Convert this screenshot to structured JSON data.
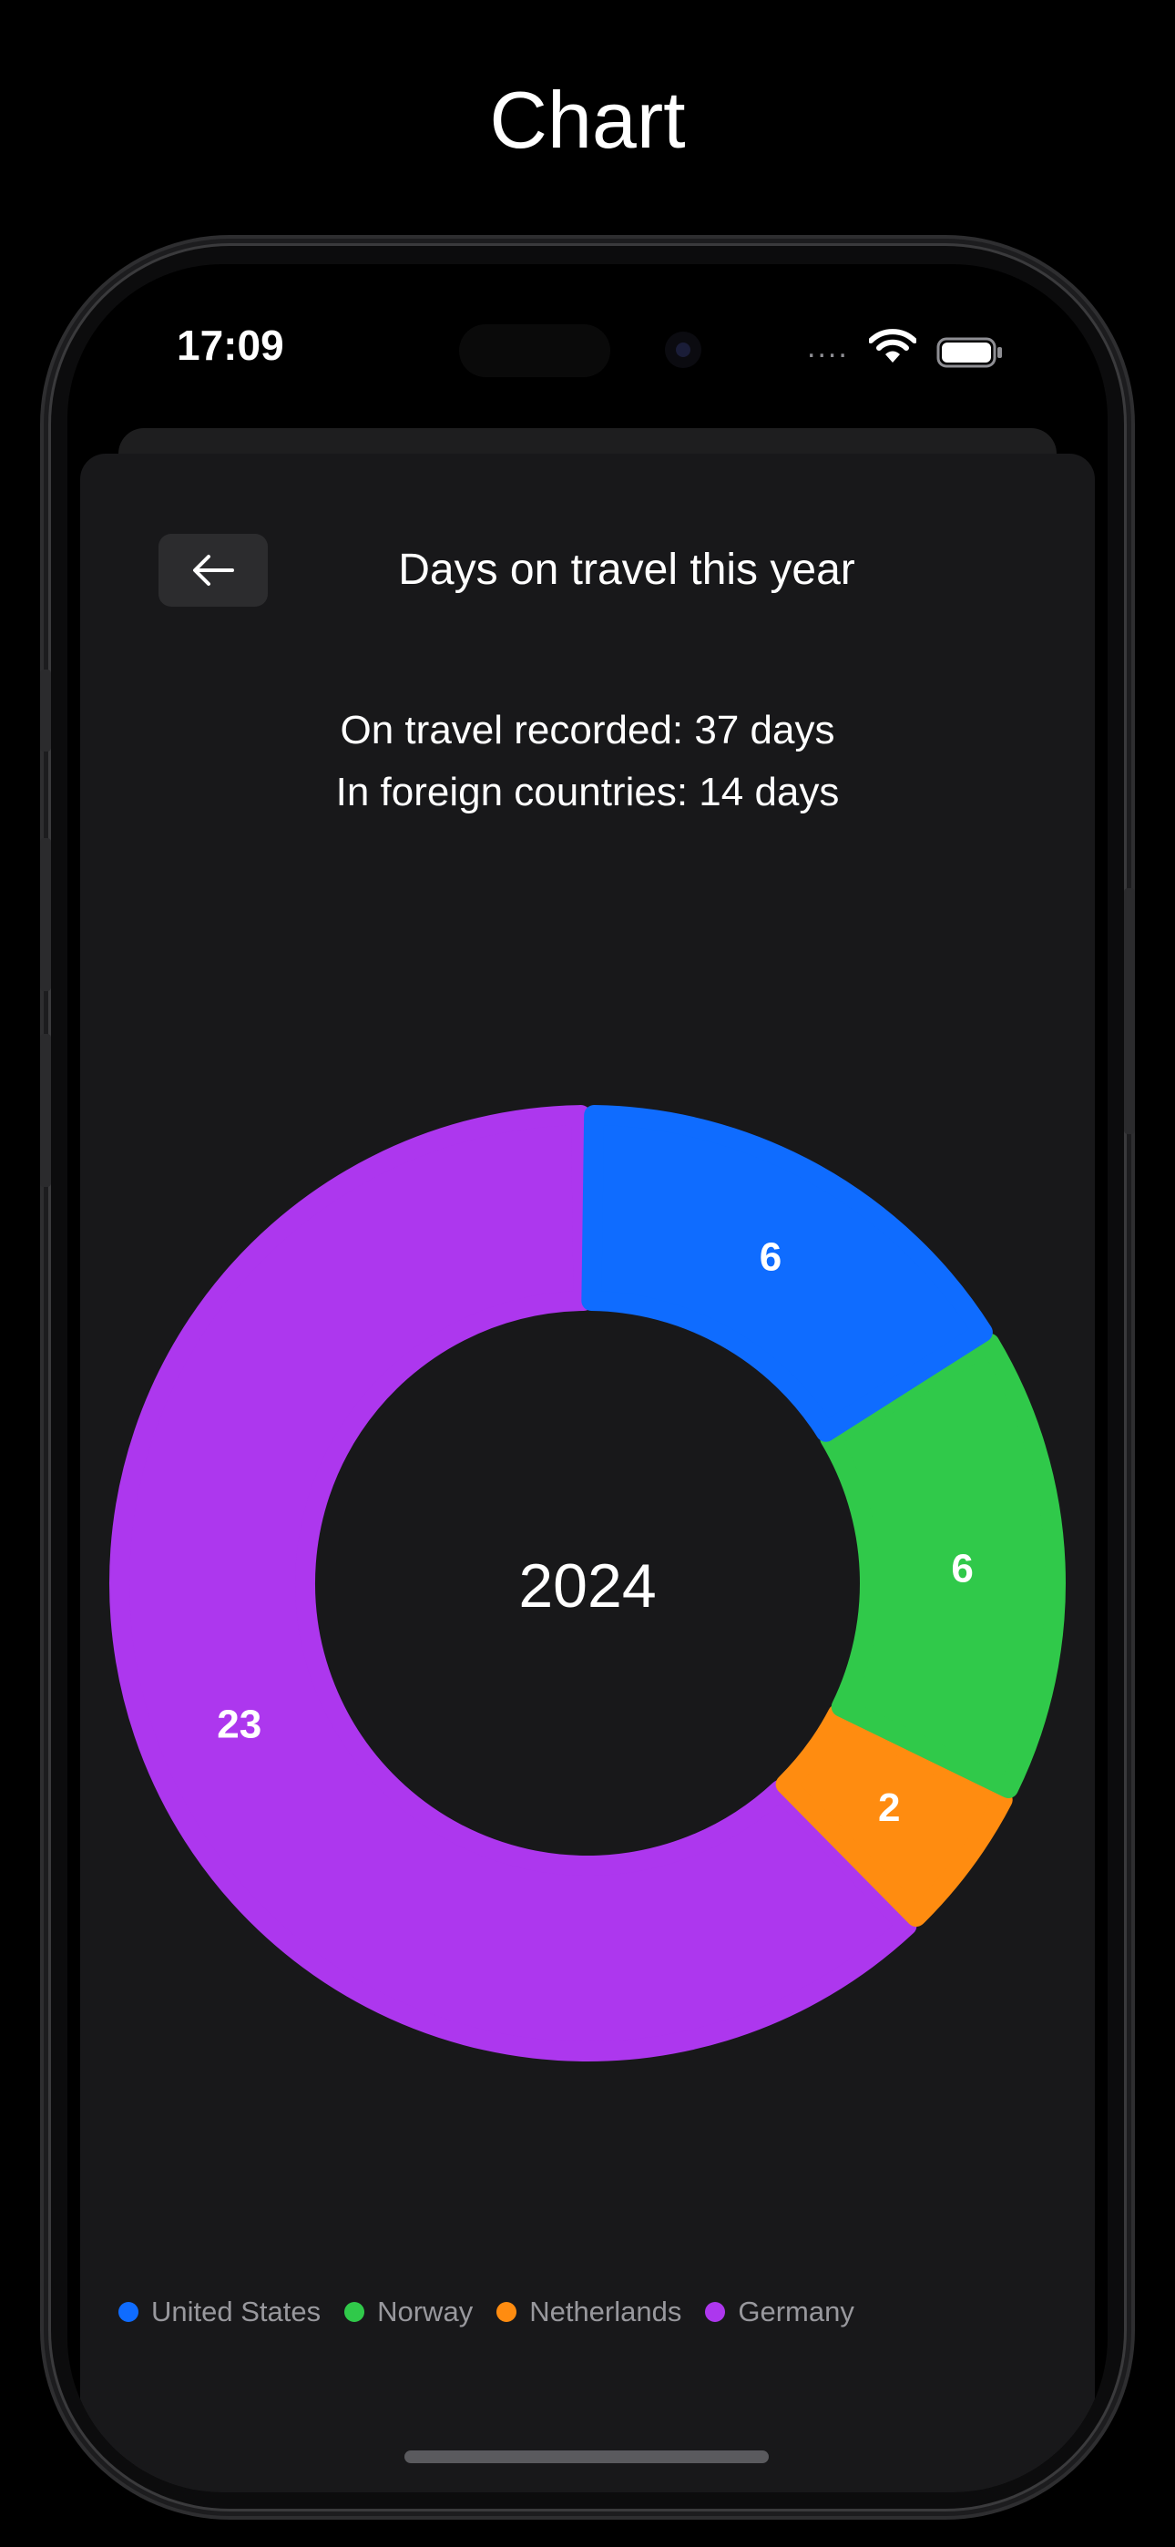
{
  "page": {
    "heading": "Chart"
  },
  "status_bar": {
    "time": "17:09",
    "signal": "....",
    "icons": [
      "wifi-icon",
      "battery-icon"
    ]
  },
  "nav": {
    "back_icon": "arrow-left-icon",
    "title": "Days on travel this year"
  },
  "summary": {
    "recorded": "On travel recorded: 37 days",
    "foreign": "In foreign countries: 14 days"
  },
  "chart_data": {
    "type": "pie",
    "title": "",
    "center_label": "2024",
    "categories": [
      "United States",
      "Norway",
      "Netherlands",
      "Germany"
    ],
    "values": [
      6,
      6,
      2,
      23
    ],
    "data_labels": [
      "6",
      "6",
      "2",
      "23"
    ],
    "colors": [
      "#0f6cff",
      "#30c94a",
      "#ff8c10",
      "#ad37ee"
    ],
    "legend_position": "bottom-left"
  },
  "legend": {
    "items": [
      {
        "label": "United States",
        "color": "#0f6cff"
      },
      {
        "label": "Norway",
        "color": "#30c94a"
      },
      {
        "label": "Netherlands",
        "color": "#ff8c10"
      },
      {
        "label": "Germany",
        "color": "#ad37ee"
      }
    ]
  },
  "colors": {
    "background": "#000000",
    "sheet": "#18181a",
    "button": "#2c2c2e",
    "legend_text": "#98989d"
  }
}
